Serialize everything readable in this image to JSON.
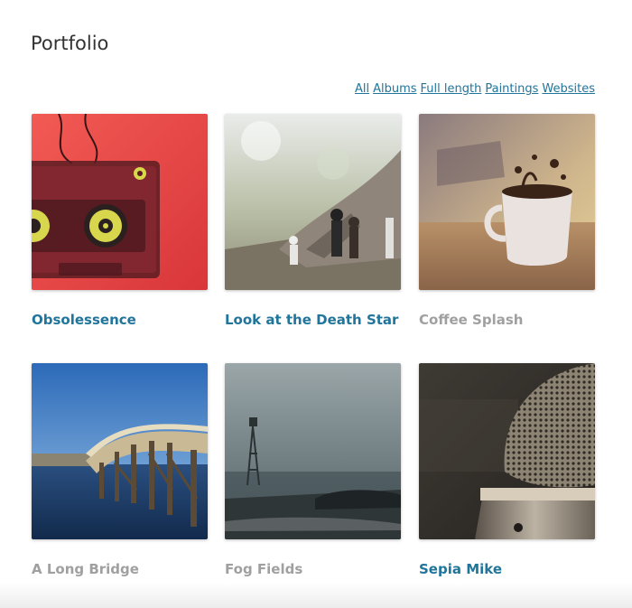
{
  "page": {
    "title": "Portfolio"
  },
  "filters": [
    "All",
    "Albums",
    "Full length",
    "Paintings",
    "Websites"
  ],
  "items": [
    {
      "title": "Obsolessence",
      "image": "cassette-tape-image",
      "linked": true
    },
    {
      "title": "Look at the Death Star",
      "image": "toy-figures-image",
      "linked": true
    },
    {
      "title": "Coffee Splash",
      "image": "coffee-cup-image",
      "linked": false
    },
    {
      "title": "A Long Bridge",
      "image": "wooden-bridge-image",
      "linked": false
    },
    {
      "title": "Fog Fields",
      "image": "foggy-windmill-image",
      "linked": false
    },
    {
      "title": "Sepia Mike",
      "image": "microphone-image",
      "linked": true
    }
  ],
  "colors": {
    "link": "#21759b",
    "muted": "#a0a0a0",
    "title": "#333333"
  }
}
